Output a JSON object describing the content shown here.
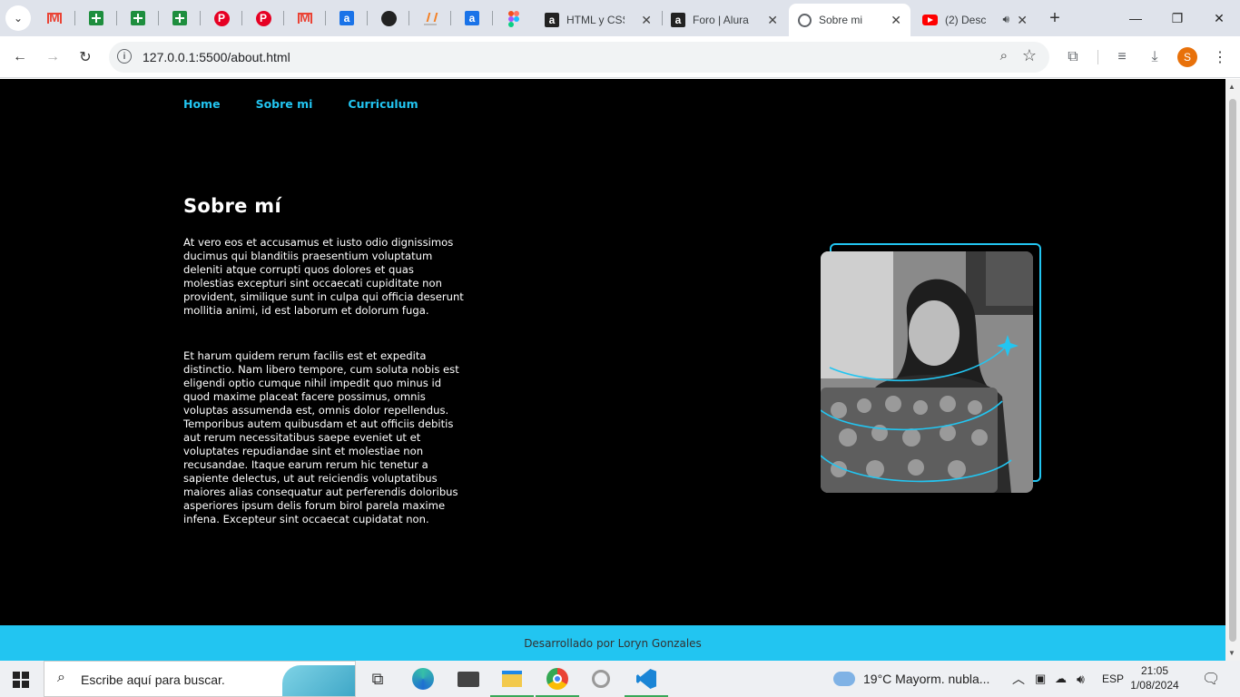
{
  "browser": {
    "tabs": [
      {
        "title": "HTML y CSS:",
        "icon": "alura-icon"
      },
      {
        "title": "Foro | Alura L",
        "icon": "alura-icon"
      },
      {
        "title": "Sobre mi",
        "icon": "globe-icon",
        "active": true
      },
      {
        "title": "(2) Desc",
        "icon": "youtube-icon"
      }
    ],
    "pinned_icons": [
      "gmail-icon",
      "sheets-icon",
      "sheets-icon",
      "sheets-icon",
      "pinterest-icon",
      "pinterest-icon",
      "gmail-icon",
      "alura-icon",
      "github-icon",
      "stackoverflow-icon",
      "alura-icon",
      "figma-icon"
    ],
    "url": "127.0.0.1:5500/about.html",
    "profile_initial": "S"
  },
  "page": {
    "nav": [
      "Home",
      "Sobre mi",
      "Curriculum"
    ],
    "title": "Sobre mí",
    "paragraph_1": "At vero eos et accusamus et iusto odio dignissimos ducimus qui blanditiis praesentium voluptatum deleniti atque corrupti quos dolores et quas molestias excepturi sint occaecati cupiditate non provident, similique sunt in culpa qui officia deserunt mollitia animi, id est laborum et dolorum fuga.",
    "paragraph_2": "Et harum quidem rerum facilis est et expedita distinctio. Nam libero tempore, cum soluta nobis est eligendi optio cumque nihil impedit quo minus id quod maxime placeat facere possimus, omnis voluptas assumenda est, omnis dolor repellendus. Temporibus autem quibusdam et aut officiis debitis aut rerum necessitatibus saepe eveniet ut et voluptates repudiandae sint et molestiae non recusandae. Itaque earum rerum hic tenetur a sapiente delectus, ut aut reiciendis voluptatibus maiores alias consequatur aut perferendis doloribus asperiores ipsum delis forum birol parela maxime infena. Excepteur sint occaecat cupidatat non.",
    "footer": "Desarrollado por Loryn Gonzales",
    "accent_color": "#22c5f1"
  },
  "taskbar": {
    "search_placeholder": "Escribe aquí para buscar.",
    "weather": "19°C  Mayorm. nubla...",
    "language": "ESP",
    "time": "21:05",
    "date": "1/08/2024"
  }
}
